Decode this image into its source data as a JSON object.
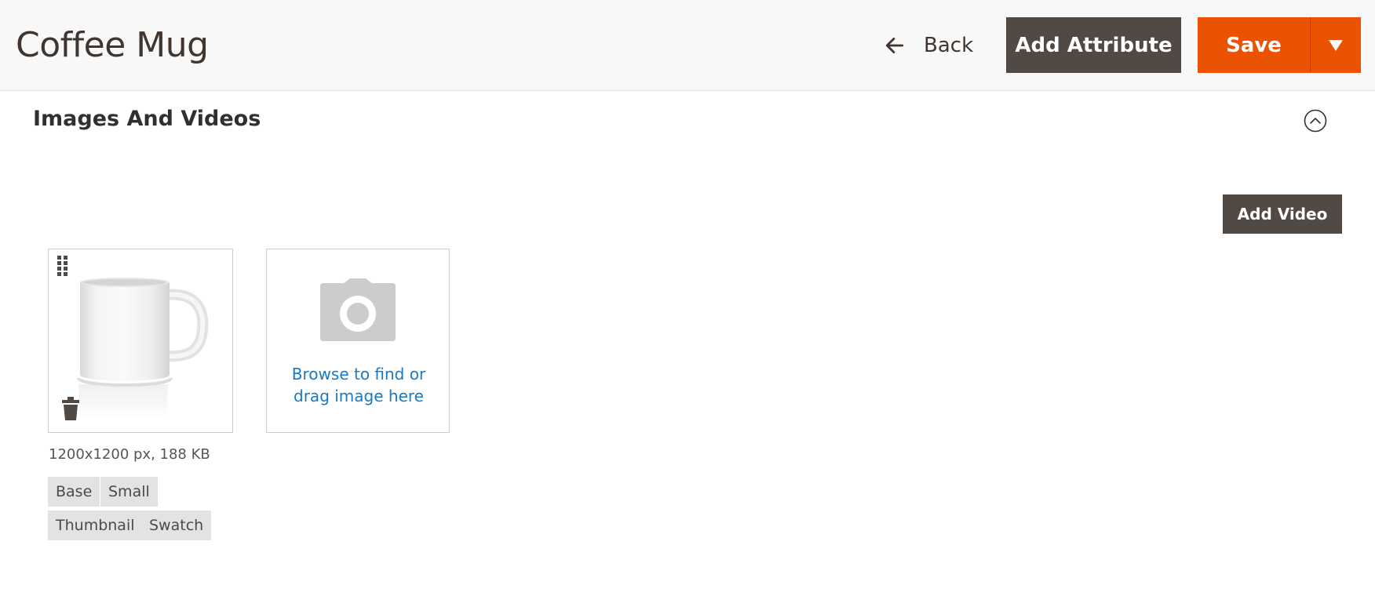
{
  "header": {
    "title": "Coffee Mug",
    "back_label": "Back",
    "add_attribute_label": "Add Attribute",
    "save_label": "Save"
  },
  "section": {
    "title": "Images And Videos",
    "add_video_label": "Add Video"
  },
  "images": [
    {
      "alt": "Coffee Mug",
      "meta": "1200x1200 px, 188 KB",
      "roles": [
        "Base",
        "Small",
        "Thumbnail",
        "Swatch"
      ]
    }
  ],
  "uploader": {
    "text_line1": "Browse to find or",
    "text_line2": "drag image here"
  },
  "colors": {
    "header_bg": "#f8f8f8",
    "dark_button": "#514943",
    "primary_button": "#eb5202",
    "link": "#1979c3",
    "tag_bg": "#e3e3e3"
  },
  "icons": [
    "arrow-left-icon",
    "caret-down-icon",
    "collapse-chevron-icon",
    "drag-handle-icon",
    "trash-icon",
    "camera-icon"
  ]
}
